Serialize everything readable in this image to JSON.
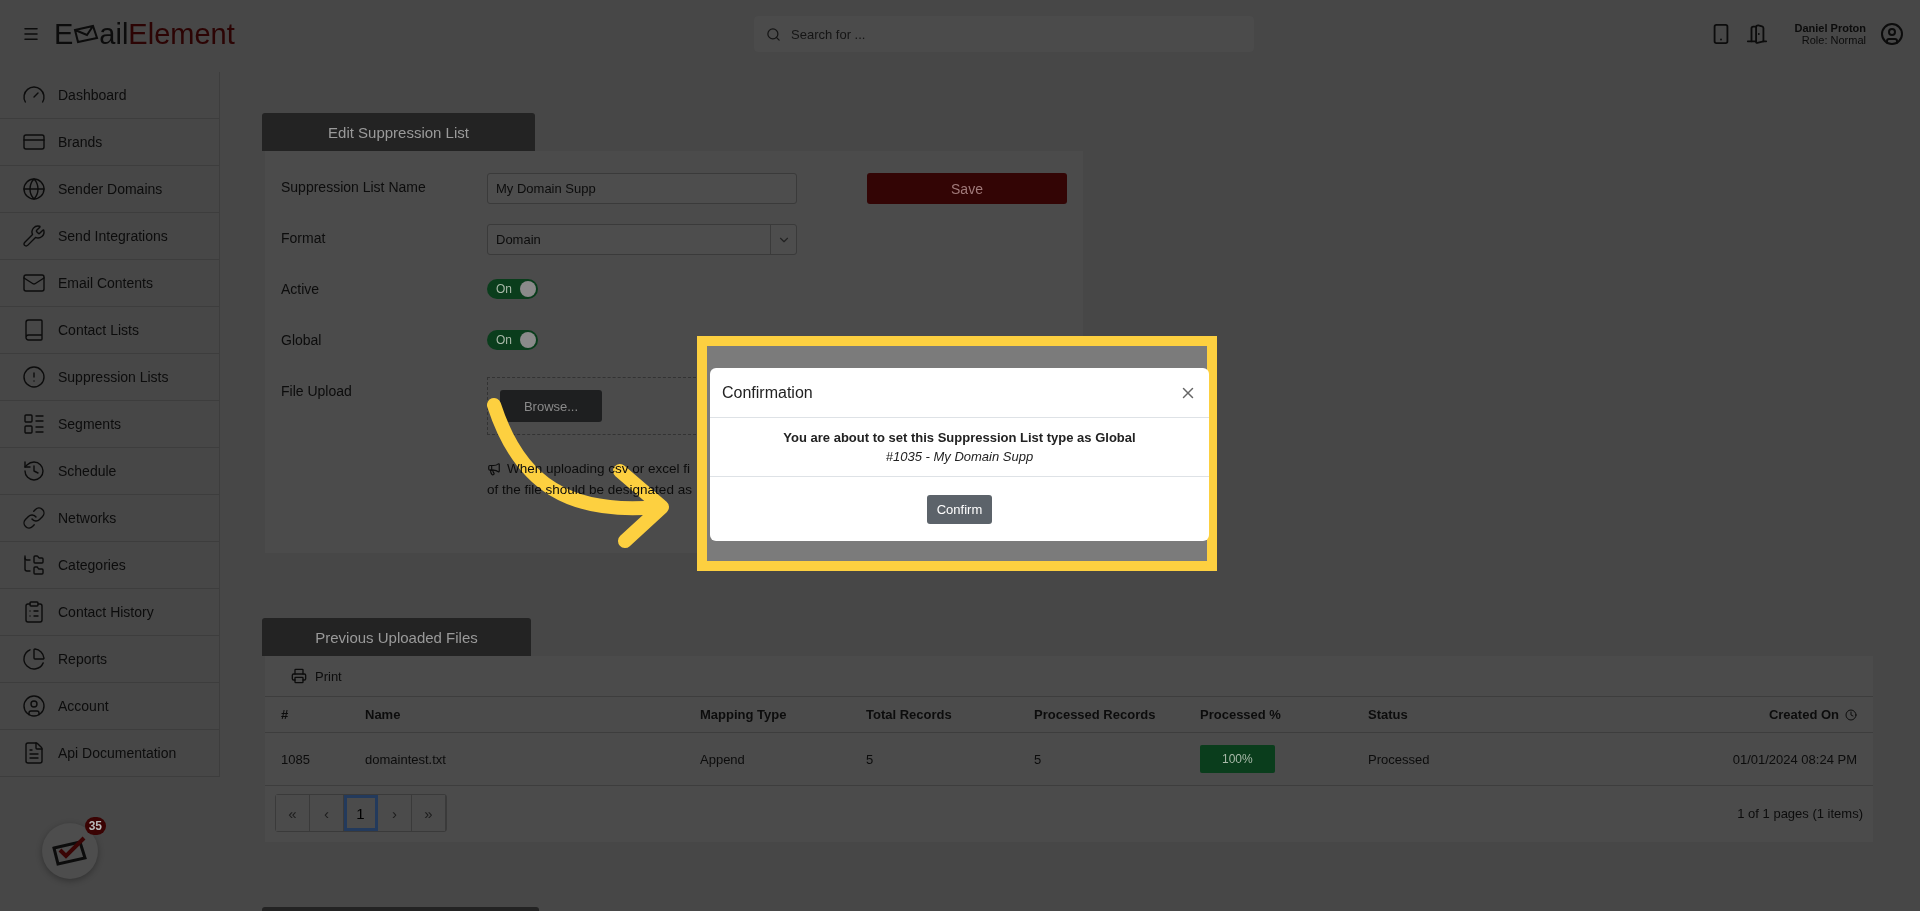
{
  "header": {
    "logo": {
      "prefix": "E",
      "middle": "ail",
      "suffix": "Element"
    },
    "search": {
      "placeholder": "Search for ..."
    },
    "user": {
      "name": "Daniel Proton",
      "role": "Role: Normal"
    }
  },
  "sidebar": {
    "items": [
      {
        "label": "Dashboard"
      },
      {
        "label": "Brands"
      },
      {
        "label": "Sender Domains"
      },
      {
        "label": "Send Integrations"
      },
      {
        "label": "Email Contents"
      },
      {
        "label": "Contact Lists"
      },
      {
        "label": "Suppression Lists"
      },
      {
        "label": "Segments"
      },
      {
        "label": "Schedule"
      },
      {
        "label": "Networks"
      },
      {
        "label": "Categories"
      },
      {
        "label": "Contact History"
      },
      {
        "label": "Reports"
      },
      {
        "label": "Account"
      },
      {
        "label": "Api Documentation"
      }
    ]
  },
  "notification": {
    "count": "35"
  },
  "edit_section": {
    "tab": "Edit Suppression List",
    "save": "Save",
    "fields": [
      {
        "kind": "text",
        "label": "Suppression List Name",
        "value": "My Domain Supp"
      },
      {
        "kind": "select",
        "label": "Format",
        "value": "Domain"
      },
      {
        "kind": "toggle",
        "label": "Active",
        "on": true,
        "text": "On"
      },
      {
        "kind": "toggle",
        "label": "Global",
        "on": true,
        "text": "On"
      },
      {
        "kind": "file",
        "label": "File Upload",
        "button": "Browse..."
      }
    ],
    "note_lines": [
      "When uploading csv or excel fi",
      "of the file should be designated as"
    ]
  },
  "files_section": {
    "tab": "Previous Uploaded Files",
    "print": "Print",
    "columns": [
      "#",
      "Name",
      "Mapping Type",
      "Total Records",
      "Processed Records",
      "Processed %",
      "Status",
      "Created On"
    ],
    "rows": [
      {
        "cells": [
          "1085",
          "domaintest.txt",
          "Append",
          "5",
          "5",
          "100%",
          "Processed",
          "01/01/2024 08:24 PM"
        ]
      }
    ],
    "pagination": [
      {
        "label": "«",
        "selected": false
      },
      {
        "label": "‹",
        "selected": false
      },
      {
        "label": "1",
        "selected": true
      },
      {
        "label": "›",
        "selected": false
      },
      {
        "label": "»",
        "selected": false
      }
    ],
    "page_info": "1 of 1 pages (1 items)"
  },
  "modal": {
    "title": "Confirmation",
    "message": "You are about to set this Suppression List type as Global",
    "detail": "#1035 - My Domain Supp",
    "confirm": "Confirm"
  }
}
